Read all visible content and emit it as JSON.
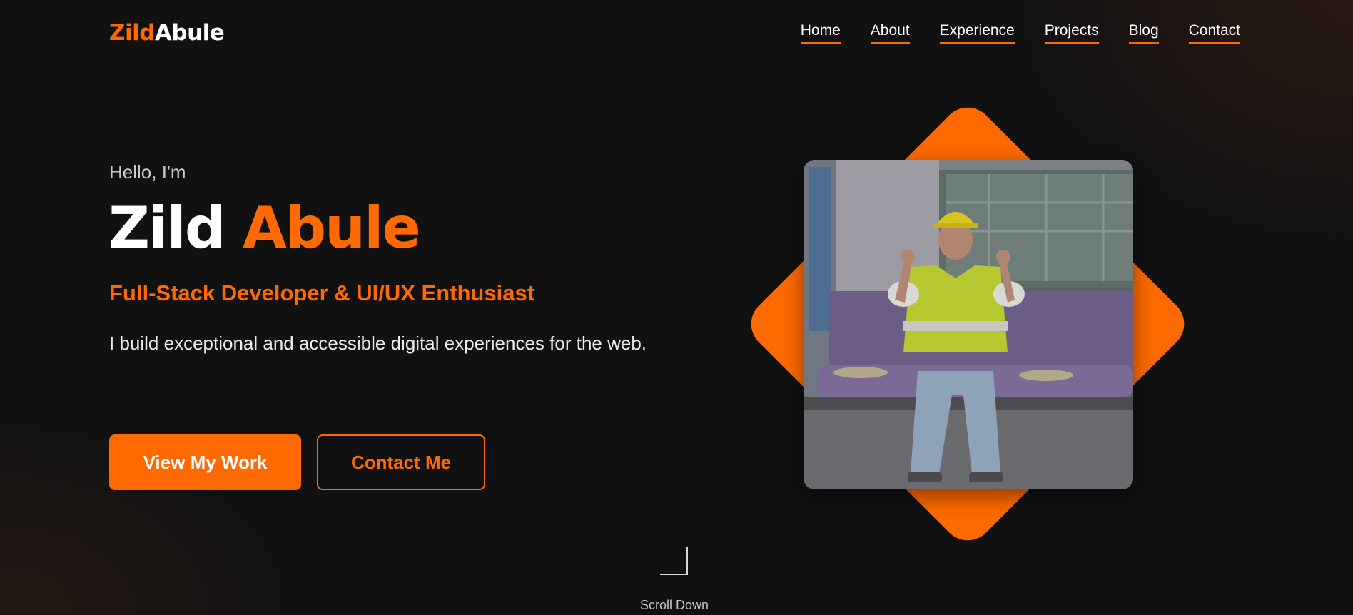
{
  "logo": {
    "first": "Zild",
    "last": "Abule"
  },
  "nav": {
    "items": [
      {
        "label": "Home"
      },
      {
        "label": "About"
      },
      {
        "label": "Experience"
      },
      {
        "label": "Projects"
      },
      {
        "label": "Blog"
      },
      {
        "label": "Contact"
      }
    ]
  },
  "hero": {
    "greeting": "Hello, I'm",
    "name_first": "Zild",
    "name_last": "Abule",
    "role": "Full-Stack Developer & UI/UX Enthusiast",
    "description": "I build exceptional and accessible digital experiences for the web.",
    "primary_button": "View My Work",
    "secondary_button": "Contact Me"
  },
  "scroll": {
    "label": "Scroll Down",
    "icon": "corner-arrow-icon"
  },
  "colors": {
    "accent": "#ff6a00",
    "background": "#111112",
    "text": "#ffffff"
  }
}
